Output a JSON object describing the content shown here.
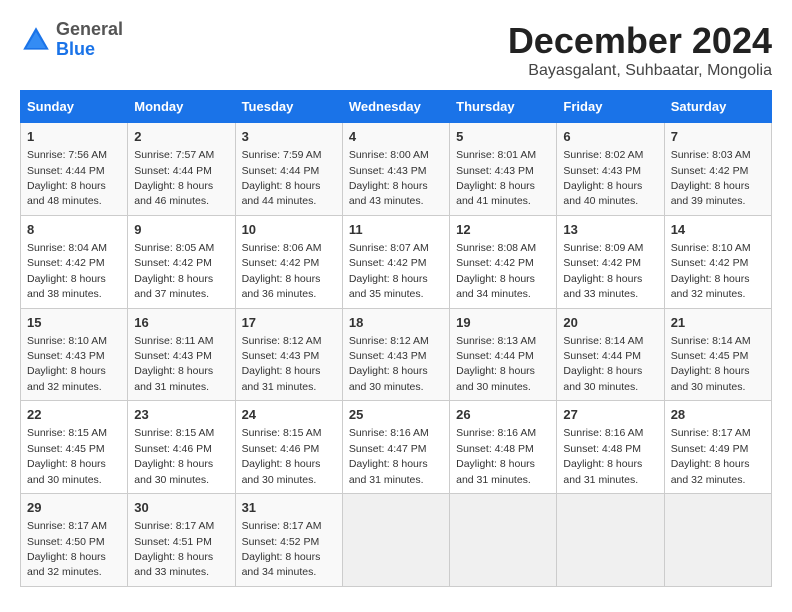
{
  "header": {
    "logo_general": "General",
    "logo_blue": "Blue",
    "month": "December 2024",
    "location": "Bayasgalant, Suhbaatar, Mongolia"
  },
  "weekdays": [
    "Sunday",
    "Monday",
    "Tuesday",
    "Wednesday",
    "Thursday",
    "Friday",
    "Saturday"
  ],
  "weeks": [
    [
      {
        "day": "1",
        "info": "Sunrise: 7:56 AM\nSunset: 4:44 PM\nDaylight: 8 hours\nand 48 minutes."
      },
      {
        "day": "2",
        "info": "Sunrise: 7:57 AM\nSunset: 4:44 PM\nDaylight: 8 hours\nand 46 minutes."
      },
      {
        "day": "3",
        "info": "Sunrise: 7:59 AM\nSunset: 4:44 PM\nDaylight: 8 hours\nand 44 minutes."
      },
      {
        "day": "4",
        "info": "Sunrise: 8:00 AM\nSunset: 4:43 PM\nDaylight: 8 hours\nand 43 minutes."
      },
      {
        "day": "5",
        "info": "Sunrise: 8:01 AM\nSunset: 4:43 PM\nDaylight: 8 hours\nand 41 minutes."
      },
      {
        "day": "6",
        "info": "Sunrise: 8:02 AM\nSunset: 4:43 PM\nDaylight: 8 hours\nand 40 minutes."
      },
      {
        "day": "7",
        "info": "Sunrise: 8:03 AM\nSunset: 4:42 PM\nDaylight: 8 hours\nand 39 minutes."
      }
    ],
    [
      {
        "day": "8",
        "info": "Sunrise: 8:04 AM\nSunset: 4:42 PM\nDaylight: 8 hours\nand 38 minutes."
      },
      {
        "day": "9",
        "info": "Sunrise: 8:05 AM\nSunset: 4:42 PM\nDaylight: 8 hours\nand 37 minutes."
      },
      {
        "day": "10",
        "info": "Sunrise: 8:06 AM\nSunset: 4:42 PM\nDaylight: 8 hours\nand 36 minutes."
      },
      {
        "day": "11",
        "info": "Sunrise: 8:07 AM\nSunset: 4:42 PM\nDaylight: 8 hours\nand 35 minutes."
      },
      {
        "day": "12",
        "info": "Sunrise: 8:08 AM\nSunset: 4:42 PM\nDaylight: 8 hours\nand 34 minutes."
      },
      {
        "day": "13",
        "info": "Sunrise: 8:09 AM\nSunset: 4:42 PM\nDaylight: 8 hours\nand 33 minutes."
      },
      {
        "day": "14",
        "info": "Sunrise: 8:10 AM\nSunset: 4:42 PM\nDaylight: 8 hours\nand 32 minutes."
      }
    ],
    [
      {
        "day": "15",
        "info": "Sunrise: 8:10 AM\nSunset: 4:43 PM\nDaylight: 8 hours\nand 32 minutes."
      },
      {
        "day": "16",
        "info": "Sunrise: 8:11 AM\nSunset: 4:43 PM\nDaylight: 8 hours\nand 31 minutes."
      },
      {
        "day": "17",
        "info": "Sunrise: 8:12 AM\nSunset: 4:43 PM\nDaylight: 8 hours\nand 31 minutes."
      },
      {
        "day": "18",
        "info": "Sunrise: 8:12 AM\nSunset: 4:43 PM\nDaylight: 8 hours\nand 30 minutes."
      },
      {
        "day": "19",
        "info": "Sunrise: 8:13 AM\nSunset: 4:44 PM\nDaylight: 8 hours\nand 30 minutes."
      },
      {
        "day": "20",
        "info": "Sunrise: 8:14 AM\nSunset: 4:44 PM\nDaylight: 8 hours\nand 30 minutes."
      },
      {
        "day": "21",
        "info": "Sunrise: 8:14 AM\nSunset: 4:45 PM\nDaylight: 8 hours\nand 30 minutes."
      }
    ],
    [
      {
        "day": "22",
        "info": "Sunrise: 8:15 AM\nSunset: 4:45 PM\nDaylight: 8 hours\nand 30 minutes."
      },
      {
        "day": "23",
        "info": "Sunrise: 8:15 AM\nSunset: 4:46 PM\nDaylight: 8 hours\nand 30 minutes."
      },
      {
        "day": "24",
        "info": "Sunrise: 8:15 AM\nSunset: 4:46 PM\nDaylight: 8 hours\nand 30 minutes."
      },
      {
        "day": "25",
        "info": "Sunrise: 8:16 AM\nSunset: 4:47 PM\nDaylight: 8 hours\nand 31 minutes."
      },
      {
        "day": "26",
        "info": "Sunrise: 8:16 AM\nSunset: 4:48 PM\nDaylight: 8 hours\nand 31 minutes."
      },
      {
        "day": "27",
        "info": "Sunrise: 8:16 AM\nSunset: 4:48 PM\nDaylight: 8 hours\nand 31 minutes."
      },
      {
        "day": "28",
        "info": "Sunrise: 8:17 AM\nSunset: 4:49 PM\nDaylight: 8 hours\nand 32 minutes."
      }
    ],
    [
      {
        "day": "29",
        "info": "Sunrise: 8:17 AM\nSunset: 4:50 PM\nDaylight: 8 hours\nand 32 minutes."
      },
      {
        "day": "30",
        "info": "Sunrise: 8:17 AM\nSunset: 4:51 PM\nDaylight: 8 hours\nand 33 minutes."
      },
      {
        "day": "31",
        "info": "Sunrise: 8:17 AM\nSunset: 4:52 PM\nDaylight: 8 hours\nand 34 minutes."
      },
      {
        "day": "",
        "info": ""
      },
      {
        "day": "",
        "info": ""
      },
      {
        "day": "",
        "info": ""
      },
      {
        "day": "",
        "info": ""
      }
    ]
  ]
}
